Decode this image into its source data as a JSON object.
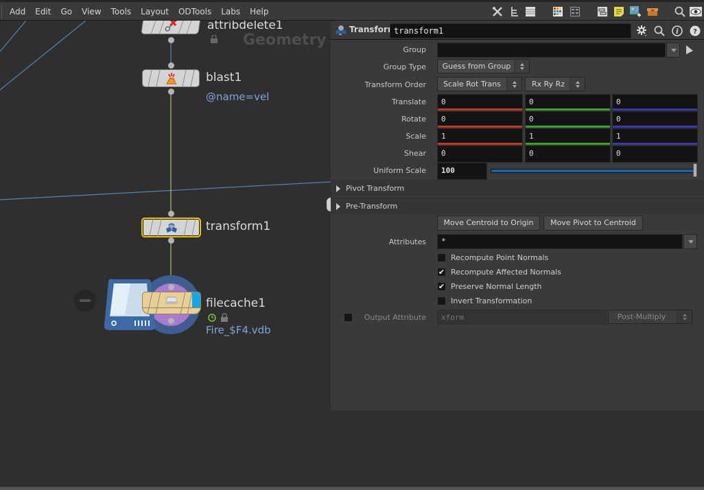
{
  "menubar": {
    "items": [
      "Add",
      "Edit",
      "Go",
      "View",
      "Tools",
      "Layout",
      "ODTools",
      "Labs",
      "Help"
    ],
    "toolbar_icons": [
      "tools-icon",
      "tree-view-icon",
      "list-view-icon",
      "color-palette-icon",
      "grid-view-icon",
      "network-box-icon",
      "sticky-note-icon",
      "add-image-icon",
      "subnet-box-icon",
      "search-icon",
      "visibility-eye-icon"
    ]
  },
  "network": {
    "context_label": "Geometry",
    "nodes": [
      {
        "name": "attribdelete1",
        "icon": "attribdelete-icon",
        "flags": [
          "lock"
        ]
      },
      {
        "name": "blast1",
        "icon": "blast-icon",
        "sub": "@name=vel"
      },
      {
        "name": "transform1",
        "icon": "transform-icon",
        "selected": true
      },
      {
        "name": "filecache1",
        "icon": "filecache-icon",
        "sub": "Fire_$F4.vdb",
        "flags": [
          "time-dependent",
          "lock"
        ]
      }
    ],
    "colors": {
      "selected_outline": "#f2c200",
      "wire_blue": "#5a82b8",
      "wire_green": "#a8c46a",
      "filecache_color": "#e8cf96",
      "sub_text": "#7ea6d8"
    }
  },
  "params": {
    "node_type": "Transform",
    "node_name": "transform1",
    "header_buttons": [
      "gear-icon",
      "search-icon",
      "info-icon",
      "help-icon"
    ],
    "group": {
      "label": "Group",
      "value": ""
    },
    "group_type": {
      "label": "Group Type",
      "value": "Guess from Group"
    },
    "transform_order": {
      "label": "Transform Order",
      "value": "Scale Rot Trans",
      "rot_order": "Rx Ry Rz"
    },
    "translate": {
      "label": "Translate",
      "values": [
        "0",
        "0",
        "0"
      ]
    },
    "rotate": {
      "label": "Rotate",
      "values": [
        "0",
        "0",
        "0"
      ]
    },
    "scale": {
      "label": "Scale",
      "values": [
        "1",
        "1",
        "1"
      ]
    },
    "shear": {
      "label": "Shear",
      "values": [
        "0",
        "0",
        "0"
      ]
    },
    "uniform_scale": {
      "label": "Uniform Scale",
      "value": "100",
      "slider_fraction": 1.0
    },
    "folders": [
      "Pivot Transform",
      "Pre-Transform"
    ],
    "buttons": {
      "move_centroid": "Move Centroid to Origin",
      "move_pivot": "Move Pivot to Centroid"
    },
    "attributes": {
      "label": "Attributes",
      "value": "*"
    },
    "checkboxes": [
      {
        "label": "Recompute Point Normals",
        "checked": false
      },
      {
        "label": "Recompute Affected Normals",
        "checked": true
      },
      {
        "label": "Preserve Normal Length",
        "checked": true
      },
      {
        "label": "Invert Transformation",
        "checked": false
      }
    ],
    "output_attribute": {
      "label": "Output Attribute",
      "placeholder": "xform",
      "mode": "Post-Multiply",
      "enabled": false
    },
    "axis_colors": {
      "x": "#c0392b",
      "y": "#3fa32a",
      "z": "#3a3aa8"
    }
  }
}
